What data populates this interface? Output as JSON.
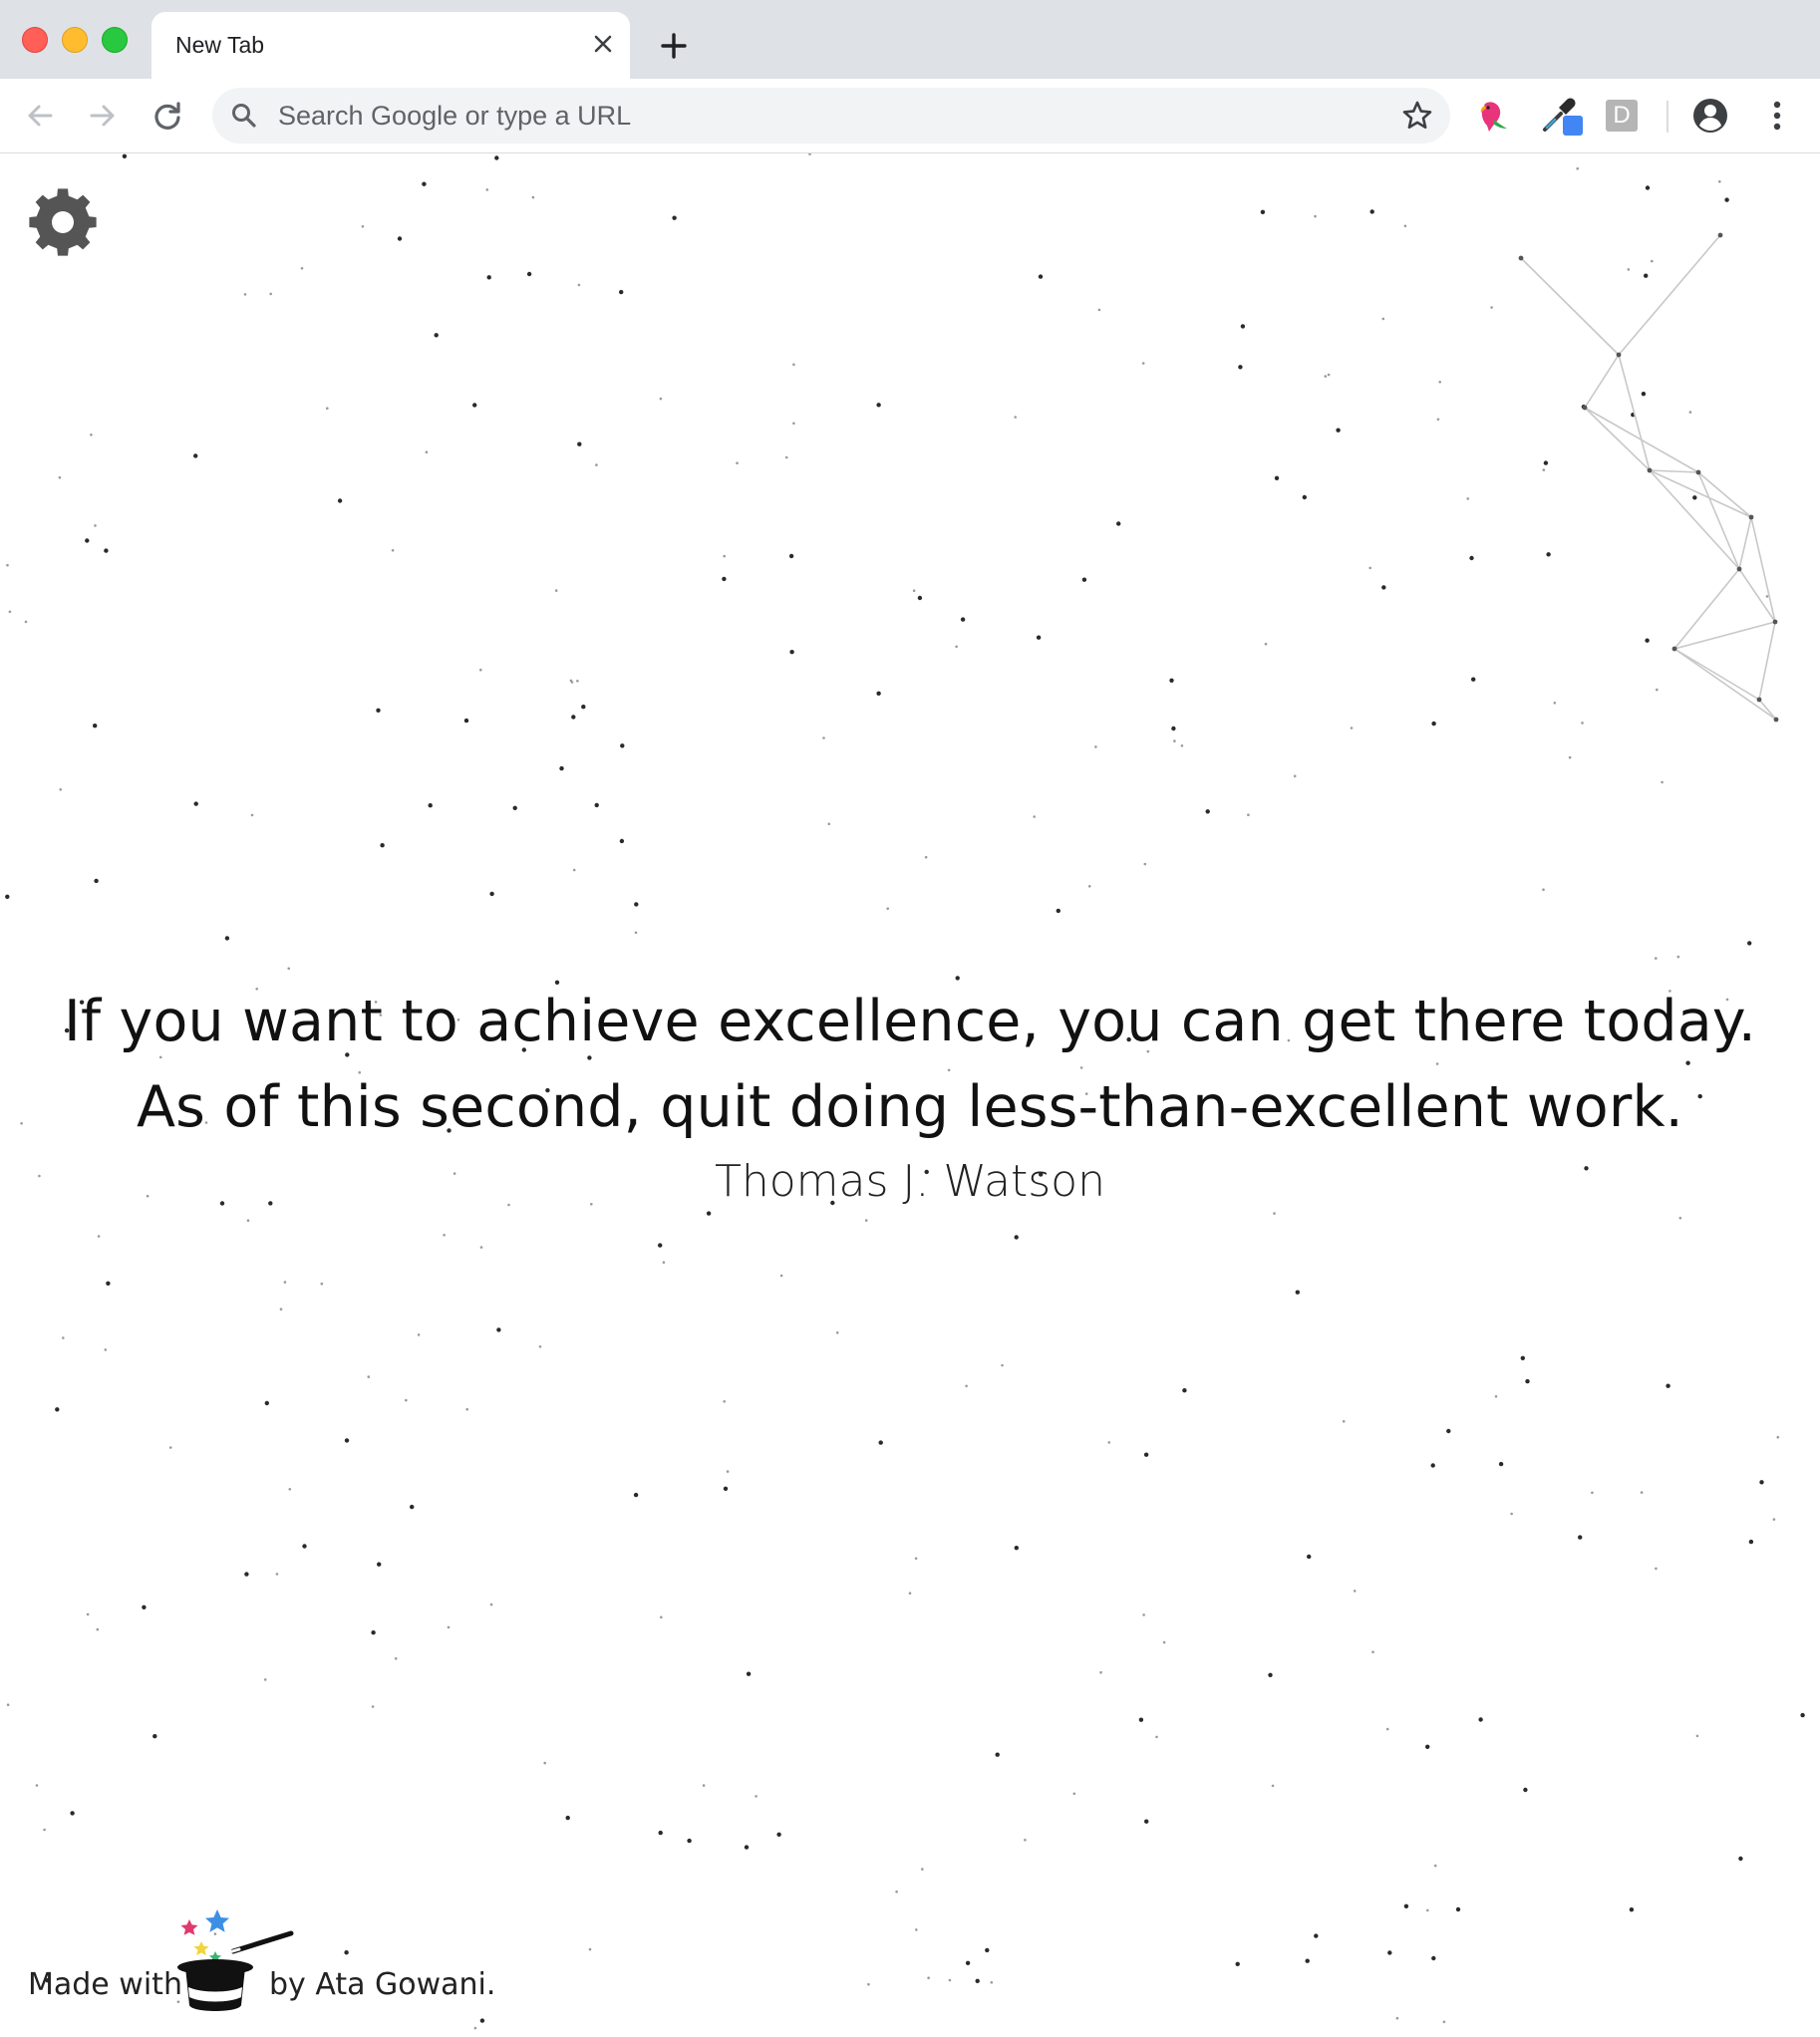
{
  "browser": {
    "tab": {
      "title": "New Tab"
    },
    "omnibox": {
      "placeholder": "Search Google or type a URL",
      "value": ""
    },
    "extensions": [
      "parrot-extension-icon",
      "color-picker-extension-icon",
      "d-extension-icon"
    ],
    "ext_d_letter": "D"
  },
  "page": {
    "quote": "If you want to achieve excellence, you can get there today. As of this second, quit doing less-than-excellent work.",
    "author": "Thomas J. Watson",
    "footer": {
      "made_with": "Made with",
      "by": "by Ata Gowani."
    }
  },
  "colors": {
    "tabstrip": "#dee1e6",
    "omnibox": "#f1f3f4",
    "traffic_close": "#ff5f57",
    "traffic_min": "#febc2e",
    "traffic_max": "#28c840",
    "settings_icon": "#555555",
    "ext_color_picker_swatch": "#4285f4"
  }
}
